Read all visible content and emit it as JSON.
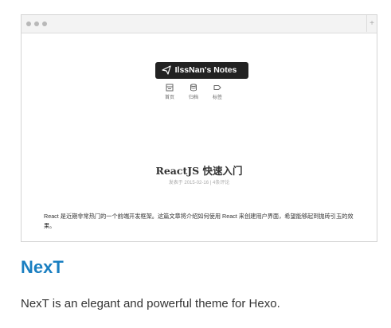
{
  "preview": {
    "brand": "IlssNan's Notes",
    "menu": [
      {
        "label": "首页",
        "icon": "home-icon"
      },
      {
        "label": "归档",
        "icon": "archive-icon"
      },
      {
        "label": "标签",
        "icon": "tag-icon"
      }
    ],
    "post": {
      "title": "ReactJS 快速入门",
      "meta": "发表于 2015-02-16  |  4条评论",
      "excerpt": "React 是近期非常热门的一个前端开发框架。这篇文章将介绍如何使用 React 来创建用户界面，希望能够起到抛砖引玉的效果。"
    }
  },
  "theme": {
    "name": "NexT",
    "description": "NexT is an elegant and powerful theme for Hexo."
  },
  "colors": {
    "accent": "#1a7fc1",
    "brand_bg": "#222222"
  }
}
